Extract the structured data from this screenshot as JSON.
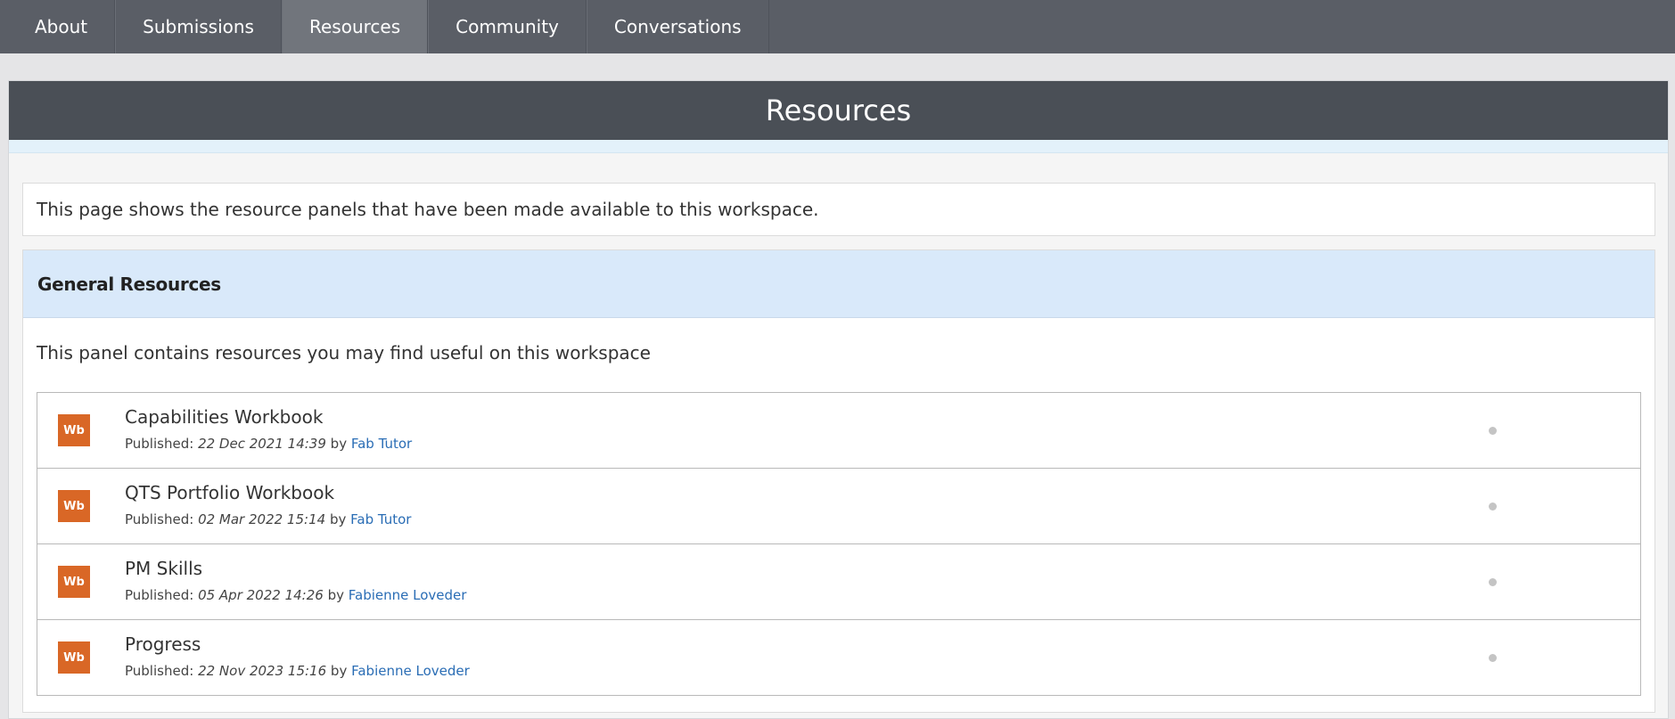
{
  "nav": {
    "tabs": [
      {
        "label": "About"
      },
      {
        "label": "Submissions"
      },
      {
        "label": "Resources"
      },
      {
        "label": "Community"
      },
      {
        "label": "Conversations"
      }
    ],
    "active": "Resources"
  },
  "page": {
    "title": "Resources",
    "intro": "This page shows the resource panels that have been made available to this workspace."
  },
  "panel": {
    "title": "General Resources",
    "description": "This panel contains resources you may find useful on this workspace",
    "items": [
      {
        "icon_text": "Wb",
        "title": "Capabilities Workbook",
        "published_label": "Published:",
        "date": "22 Dec 2021 14:39",
        "by_label": "by",
        "author": "Fab Tutor"
      },
      {
        "icon_text": "Wb",
        "title": "QTS Portfolio Workbook",
        "published_label": "Published:",
        "date": "02 Mar 2022 15:14",
        "by_label": "by",
        "author": "Fab Tutor"
      },
      {
        "icon_text": "Wb",
        "title": "PM Skills",
        "published_label": "Published:",
        "date": "05 Apr 2022 14:26",
        "by_label": "by",
        "author": "Fabienne Loveder"
      },
      {
        "icon_text": "Wb",
        "title": "Progress",
        "published_label": "Published:",
        "date": "22 Nov 2023 15:16",
        "by_label": "by",
        "author": "Fabienne Loveder"
      }
    ]
  },
  "colors": {
    "nav_bg": "#5a5e66",
    "nav_active": "#71757c",
    "header_bg": "#4a4f56",
    "panel_title_bg": "#d9e9fa",
    "icon_orange": "#d96726",
    "link_blue": "#2a6db5"
  }
}
